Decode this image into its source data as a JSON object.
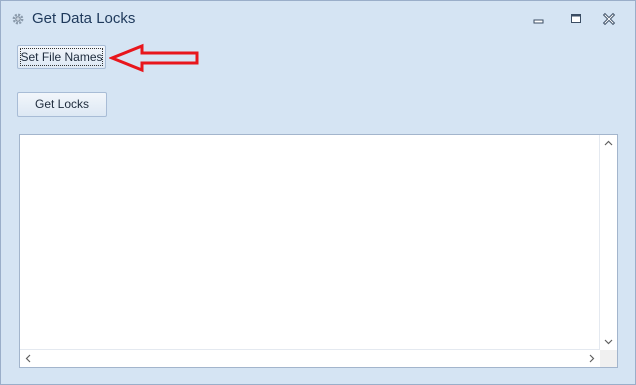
{
  "window": {
    "title": "Get Data Locks",
    "title_icon": "gear-icon",
    "controls": {
      "minimize_icon": "minimize-icon",
      "maximize_icon": "maximize-icon",
      "close_icon": "close-icon"
    }
  },
  "buttons": {
    "set_file_names": "Set File Names",
    "get_locks": "Get Locks"
  },
  "annotation": {
    "arrow_icon": "left-arrow-icon",
    "arrow_color": "#e8161c"
  },
  "output": {
    "text": ""
  },
  "colors": {
    "window_bg": "#d5e4f3",
    "title_text": "#1e395b"
  }
}
